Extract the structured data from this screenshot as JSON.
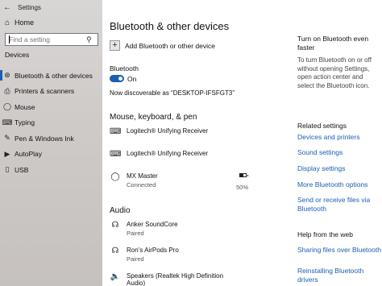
{
  "window": {
    "title": "Settings"
  },
  "sidebar": {
    "home_label": "Home",
    "search_placeholder": "Find a setting",
    "section_label": "Devices",
    "items": [
      {
        "label": "Bluetooth & other devices",
        "icon": "bluetooth-icon",
        "active": true
      },
      {
        "label": "Printers & scanners",
        "icon": "printer-icon"
      },
      {
        "label": "Mouse",
        "icon": "mouse-icon"
      },
      {
        "label": "Typing",
        "icon": "keyboard-icon"
      },
      {
        "label": "Pen & Windows Ink",
        "icon": "pen-icon"
      },
      {
        "label": "AutoPlay",
        "icon": "autoplay-icon"
      },
      {
        "label": "USB",
        "icon": "usb-icon"
      }
    ]
  },
  "main": {
    "title": "Bluetooth & other devices",
    "add_label": "Add Bluetooth or other device",
    "bluetooth_label": "Bluetooth",
    "toggle_state": "On",
    "discoverable_text": "Now discoverable as “DESKTOP-IFSFGT3”",
    "mouse_section": "Mouse, keyboard, & pen",
    "mouse_devices": [
      {
        "name": "Logitech® Unifying Receiver",
        "status": ""
      },
      {
        "name": "Logitech® Unifying Receiver",
        "status": ""
      },
      {
        "name": "MX Master",
        "status": "Connected",
        "battery": "50%"
      }
    ],
    "audio_section": "Audio",
    "audio_devices": [
      {
        "name": "Anker SoundCore",
        "status": "Paired"
      },
      {
        "name": "Ron’s AirPods Pro",
        "status": "Paired"
      },
      {
        "name": "Speakers (Realtek High Definition Audio)",
        "status": ""
      }
    ]
  },
  "right": {
    "turn_on_heading": "Turn on Bluetooth even faster",
    "turn_on_text": "To turn Bluetooth on or off without opening Settings, open action center and select the Bluetooth icon.",
    "related_heading": "Related settings",
    "related_links": [
      "Devices and printers",
      "Sound settings",
      "Display settings",
      "More Bluetooth options",
      "Send or receive files via Bluetooth"
    ],
    "help_heading": "Help from the web",
    "help_links": [
      "Sharing files over Bluetooth",
      "Reinstalling Bluetooth drivers"
    ]
  },
  "colors": {
    "accent": "#1a5fb4",
    "sidebar_bg": "#d3cfcd"
  }
}
